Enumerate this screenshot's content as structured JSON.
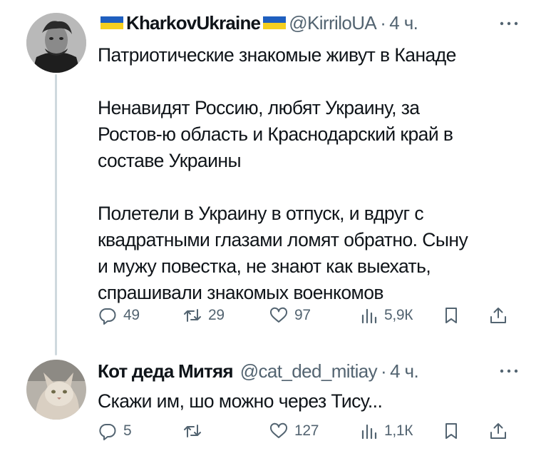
{
  "tweets": [
    {
      "author": {
        "name": "KharkovUkraine",
        "handle": "@KirriloUA",
        "time": "4 ч."
      },
      "text_lines": [
        "Патриотические знакомые живут в Канаде",
        "",
        "Ненавидят Россию, любят Украину, за",
        "Ростов-ю область и Краснодарский край в",
        "составе Украины",
        "",
        "Полетели в Украину в отпуск, и вдруг с",
        "квадратными глазами ломят обратно. Сыну",
        "и мужу повестка, не знают как выехать,",
        "спрашивали знакомых военкомов"
      ],
      "stats": {
        "replies": "49",
        "retweets": "29",
        "likes": "97",
        "views": "5,9К"
      }
    },
    {
      "author": {
        "name": "Кот деда Митяя",
        "handle": "@cat_ded_mitiay",
        "time": "4 ч."
      },
      "text_lines": [
        "Скажи им, шо можно через Тису..."
      ],
      "stats": {
        "replies": "5",
        "retweets": "",
        "likes": "127",
        "views": "1,1К"
      }
    }
  ],
  "colors": {
    "text": "#0f1419",
    "secondary": "#536471",
    "thread_line": "#cfd9de",
    "flag_blue": "#1f5fbf",
    "flag_yellow": "#f5cf1f"
  },
  "icons": [
    "ukraine-flag-icon",
    "more-icon",
    "reply-icon",
    "retweet-icon",
    "like-icon",
    "views-icon",
    "bookmark-icon",
    "share-icon"
  ]
}
